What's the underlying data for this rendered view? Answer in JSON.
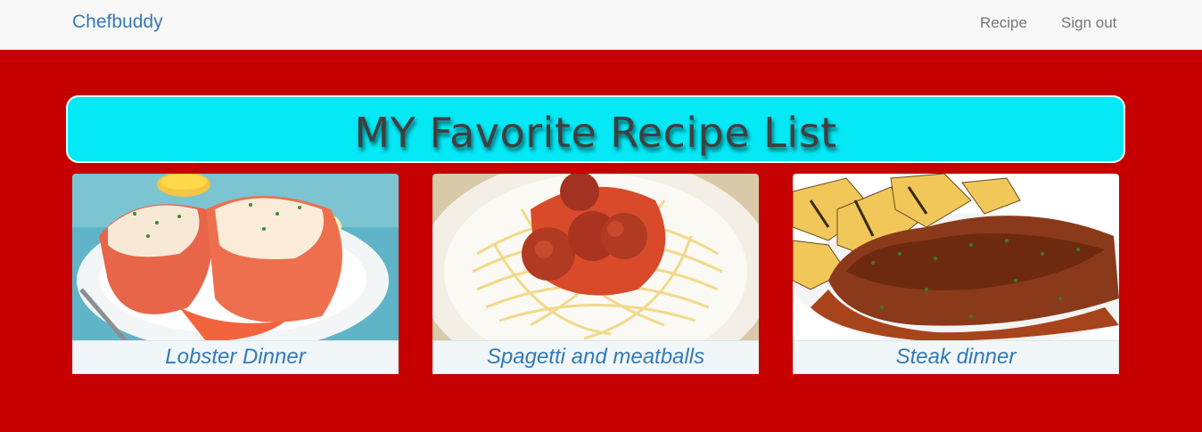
{
  "navbar": {
    "brand": "Chefbuddy",
    "links": [
      {
        "label": "Recipe"
      },
      {
        "label": "Sign out"
      }
    ]
  },
  "hero": {
    "title": "MY Favorite Recipe List"
  },
  "recipes": [
    {
      "name": "Lobster Dinner",
      "image": "lobster-dinner-photo"
    },
    {
      "name": "Spagetti and meatballs",
      "image": "spaghetti-meatballs-photo"
    },
    {
      "name": "Steak dinner",
      "image": "steak-dinner-photo"
    }
  ],
  "colors": {
    "page_background": "#c60000",
    "navbar_background": "#f8f8f8",
    "brand": "#337ab7",
    "hero_background": "#05e8f5",
    "caption_background": "#f1f7f8"
  }
}
